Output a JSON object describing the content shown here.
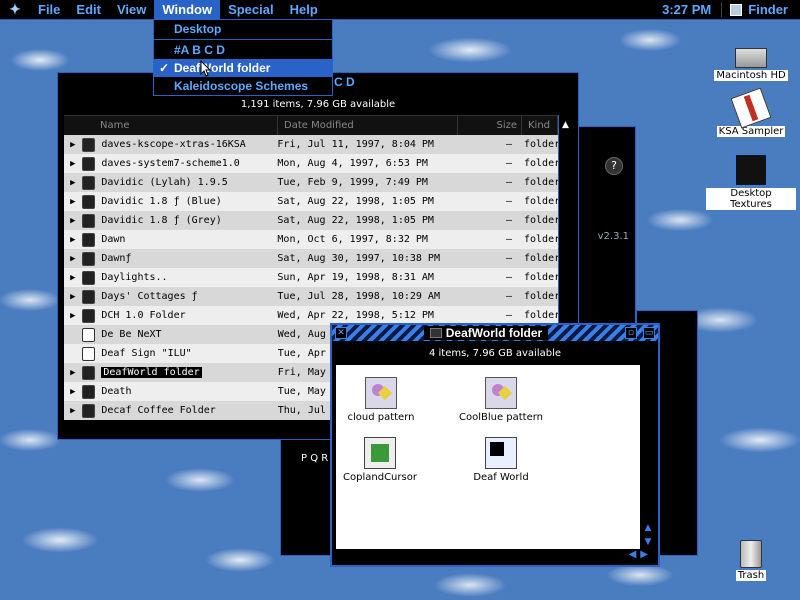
{
  "menubar": {
    "apple_icon": "apple-logo-icon",
    "menus": [
      "File",
      "Edit",
      "View",
      "Window",
      "Special",
      "Help"
    ],
    "clock": "3:27 PM",
    "app_name": "Finder"
  },
  "window_menu": {
    "items": [
      {
        "label": "Desktop",
        "checked": false
      },
      {
        "label": "#A B C D",
        "checked": false
      },
      {
        "label": "DeafWorld folder",
        "checked": true
      },
      {
        "label": "Kaleidoscope Schemes",
        "checked": false
      }
    ],
    "check_glyph": "✓"
  },
  "list_window": {
    "info": "1,191 items, 7.96 GB available",
    "columns": {
      "name": "Name",
      "date": "Date Modified",
      "size": "Size",
      "kind": "Kind"
    },
    "partial_title": "C D",
    "rows": [
      {
        "name": "daves-kscope-xtras-16KSA",
        "date": "Fri, Jul 11, 1997, 8:04 PM",
        "size": "—",
        "kind": "folder",
        "expand": "▶",
        "icon": "folder"
      },
      {
        "name": "daves-system7-scheme1.0",
        "date": "Mon, Aug 4, 1997, 6:53 PM",
        "size": "—",
        "kind": "folder",
        "expand": "▶",
        "icon": "folder"
      },
      {
        "name": "Davidic (Lylah) 1.9.5",
        "date": "Tue, Feb 9, 1999, 7:49 PM",
        "size": "—",
        "kind": "folder",
        "expand": "▶",
        "icon": "folder"
      },
      {
        "name": "Davidic 1.8 ƒ (Blue)",
        "date": "Sat, Aug 22, 1998, 1:05 PM",
        "size": "—",
        "kind": "folder",
        "expand": "▶",
        "icon": "folder"
      },
      {
        "name": "Davidic 1.8 ƒ (Grey)",
        "date": "Sat, Aug 22, 1998, 1:05 PM",
        "size": "—",
        "kind": "folder",
        "expand": "▶",
        "icon": "folder"
      },
      {
        "name": "Dawn",
        "date": "Mon, Oct 6, 1997, 8:32 PM",
        "size": "—",
        "kind": "folder",
        "expand": "▶",
        "icon": "folder"
      },
      {
        "name": "Dawnƒ",
        "date": "Sat, Aug 30, 1997, 10:38 PM",
        "size": "—",
        "kind": "folder",
        "expand": "▶",
        "icon": "folder"
      },
      {
        "name": "Daylights..",
        "date": "Sun, Apr 19, 1998, 8:31 AM",
        "size": "—",
        "kind": "folder",
        "expand": "▶",
        "icon": "folder"
      },
      {
        "name": "Days' Cottages ƒ",
        "date": "Tue, Jul 28, 1998, 10:29 AM",
        "size": "—",
        "kind": "folder",
        "expand": "▶",
        "icon": "folder"
      },
      {
        "name": "DCH 1.0 Folder",
        "date": "Wed, Apr 22, 1998, 5:12 PM",
        "size": "—",
        "kind": "folder",
        "expand": "▶",
        "icon": "folder"
      },
      {
        "name": "De Be NeXT",
        "date": "Wed, Aug",
        "size": "",
        "kind": "",
        "expand": "",
        "icon": "doc"
      },
      {
        "name": "Deaf Sign \"ILU\"",
        "date": "Tue, Apr",
        "size": "",
        "kind": "",
        "expand": "",
        "icon": "doc"
      },
      {
        "name": "DeafWorld folder",
        "date": "Fri, May",
        "size": "",
        "kind": "",
        "expand": "▶",
        "icon": "folder",
        "selected": true
      },
      {
        "name": "Death",
        "date": "Tue, May",
        "size": "",
        "kind": "",
        "expand": "▶",
        "icon": "folder"
      },
      {
        "name": "Decaf Coffee Folder",
        "date": "Thu, Jul 2",
        "size": "",
        "kind": "",
        "expand": "▶",
        "icon": "folder"
      }
    ],
    "scroll_up_glyph": "▲"
  },
  "back_window": {
    "help_glyph": "?",
    "version": "v2.3.1",
    "partial_text": "P Q R"
  },
  "icon_window": {
    "title": "DeafWorld folder",
    "close_glyph": "✕",
    "zoom_glyph": "▫",
    "collapse_glyph": "▭",
    "info": "4 items, 7.96 GB available",
    "scroll_up_glyph": "▲",
    "scroll_down_glyph": "▼",
    "scroll_left_glyph": "◀",
    "scroll_right_glyph": "▶",
    "items": [
      {
        "label": "cloud pattern",
        "icon": "pattern-file-icon"
      },
      {
        "label": "CoolBlue pattern",
        "icon": "pattern-file-icon"
      },
      {
        "label": "CoplandCursor",
        "icon": "cursor-file-icon"
      },
      {
        "label": "Deaf World",
        "icon": "deaf-world-document-icon"
      }
    ]
  },
  "desktop_icons": [
    {
      "label": "Macintosh HD",
      "icon": "hard-drive-icon"
    },
    {
      "label": "KSA Sampler",
      "icon": "ksa-sampler-icon"
    },
    {
      "label": "Desktop Textures",
      "icon": "desktop-textures-icon"
    },
    {
      "label": "Trash",
      "icon": "trash-icon"
    }
  ],
  "colors": {
    "accent": "#2a63c8",
    "window_bg": "#000000",
    "menu_text": "#5fa8ff",
    "desktop": "#4a7cc0"
  }
}
